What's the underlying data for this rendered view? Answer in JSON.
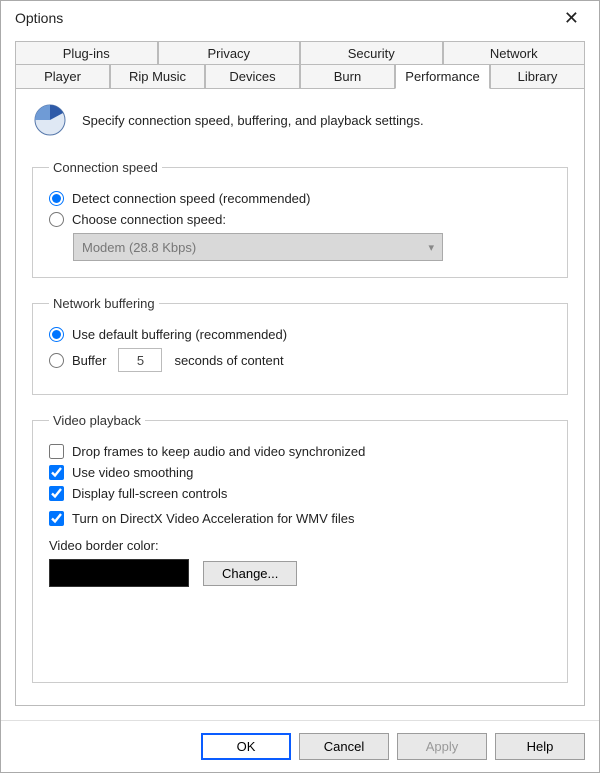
{
  "window": {
    "title": "Options"
  },
  "tabs_row1": [
    "Plug-ins",
    "Privacy",
    "Security",
    "Network"
  ],
  "tabs_row2": [
    "Player",
    "Rip Music",
    "Devices",
    "Burn",
    "Performance",
    "Library"
  ],
  "active_tab": "Performance",
  "intro": "Specify connection speed, buffering, and playback settings.",
  "groups": {
    "conn": {
      "legend": "Connection speed",
      "detect": "Detect connection speed (recommended)",
      "choose": "Choose connection speed:",
      "select_value": "Modem (28.8 Kbps)"
    },
    "buff": {
      "legend": "Network buffering",
      "defaultb": "Use default buffering (recommended)",
      "buffer": "Buffer",
      "buffer_value": "5",
      "buffer_suffix": "seconds of content"
    },
    "vid": {
      "legend": "Video playback",
      "drop": "Drop frames to keep audio and video synchronized",
      "smooth": "Use video smoothing",
      "fullscreen": "Display full-screen controls",
      "directx": "Turn on DirectX Video Acceleration for WMV files",
      "border_label": "Video border color:",
      "change": "Change..."
    }
  },
  "buttons": {
    "ok": "OK",
    "cancel": "Cancel",
    "apply": "Apply",
    "help": "Help"
  }
}
